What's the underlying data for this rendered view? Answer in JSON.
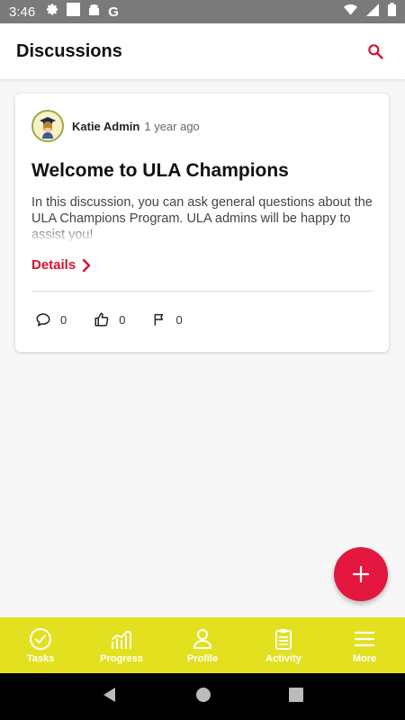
{
  "status_bar": {
    "time": "3:46",
    "left_icons": [
      "gear-icon",
      "square-icon",
      "android-icon",
      "google-icon"
    ],
    "right_icons": [
      "wifi-icon",
      "signal-icon",
      "battery-icon"
    ]
  },
  "app_bar": {
    "title": "Discussions",
    "search_icon": "search-icon",
    "accent": "#d6112f"
  },
  "discussion": {
    "author": "Katie Admin",
    "time_ago": "1 year ago",
    "title": "Welcome to ULA Champions",
    "body": "In this discussion, you can ask general questions about the ULA Champions Program. ULA admins will be happy to assist you!",
    "details_label": "Details",
    "stats": {
      "comments": "0",
      "likes": "0",
      "flags": "0"
    }
  },
  "fab": {
    "icon": "plus-icon",
    "color": "#e4173f"
  },
  "bottom_nav": {
    "background": "#e3e020",
    "items": [
      {
        "label": "Tasks",
        "icon": "check-circle-icon"
      },
      {
        "label": "Progress",
        "icon": "chart-icon"
      },
      {
        "label": "Profile",
        "icon": "person-icon"
      },
      {
        "label": "Activity",
        "icon": "clipboard-icon"
      },
      {
        "label": "More",
        "icon": "menu-icon"
      }
    ]
  }
}
